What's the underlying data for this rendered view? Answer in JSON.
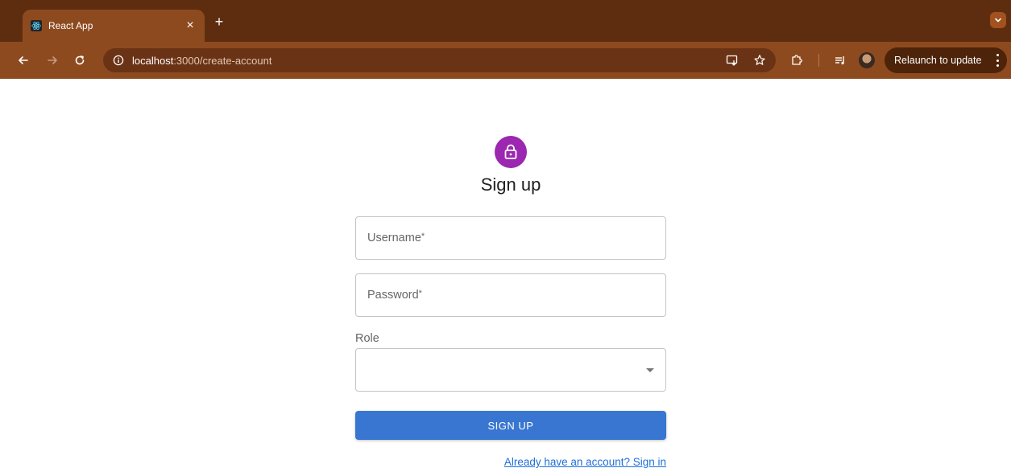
{
  "browser": {
    "tab_title": "React App",
    "tab_close": "×",
    "new_tab": "+",
    "url_host": "localhost",
    "url_path": ":3000/create-account",
    "relaunch_label": "Relaunch to update"
  },
  "icons": {
    "favicon": "react-icon",
    "back": "arrow-left-icon",
    "forward": "arrow-right-icon",
    "reload": "reload-icon",
    "site_info": "info-icon",
    "cast": "install-app-icon",
    "bookmark": "star-icon",
    "extensions": "puzzle-icon",
    "media": "media-controls-icon",
    "lock": "lock-icon",
    "dropdown": "arrow-drop-down-icon"
  },
  "form": {
    "title": "Sign up",
    "username_label": "Username",
    "password_label": "Password",
    "required_mark": "*",
    "role_label": "Role",
    "role_value": "",
    "submit_label": "SIGN UP",
    "signin_link": "Already have an account? Sign in"
  },
  "colors": {
    "tabbar": "#5e2d10",
    "toolbar": "#8e4a1f",
    "avatar_bg": "#9c27b0",
    "primary": "#3976d1",
    "link": "#1e6fd9"
  }
}
